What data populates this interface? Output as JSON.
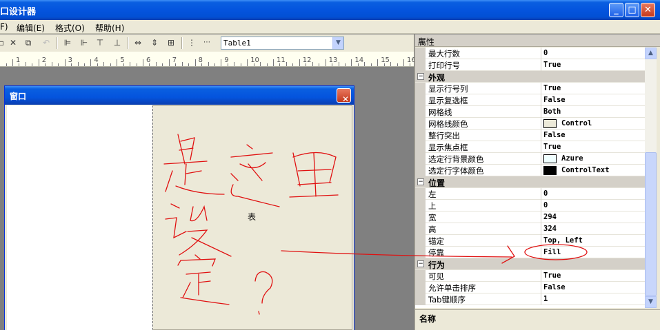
{
  "window": {
    "title": "口设计器",
    "min_glyph": "_",
    "max_glyph": "□",
    "close_glyph": "✕"
  },
  "menu": [
    {
      "label": "F)"
    },
    {
      "label": "编辑(E)"
    },
    {
      "label": "格式(O)"
    },
    {
      "label": "帮助(H)"
    }
  ],
  "toolbar": {
    "object_combo_value": "Table1"
  },
  "ruler": {
    "numbers": [
      "1",
      "2",
      "3",
      "4",
      "5",
      "6",
      "7",
      "8",
      "9",
      "10",
      "11",
      "12",
      "13",
      "14",
      "15",
      "16"
    ]
  },
  "designer": {
    "window_title": "窗口",
    "table_label": "表"
  },
  "annotation": {
    "handwritten_text": "是这里设定?"
  },
  "properties": {
    "header": "属性",
    "rows": [
      {
        "type": "prop",
        "label": "最大行数",
        "value": "0"
      },
      {
        "type": "prop",
        "label": "打印行号",
        "value": "True"
      },
      {
        "type": "cat",
        "label": "外观"
      },
      {
        "type": "prop",
        "label": "显示行号列",
        "value": "True"
      },
      {
        "type": "prop",
        "label": "显示复选框",
        "value": "False"
      },
      {
        "type": "prop",
        "label": "网格线",
        "value": "Both"
      },
      {
        "type": "prop",
        "label": "网格线颜色",
        "value": "Control",
        "swatch": "#ece9d8"
      },
      {
        "type": "prop",
        "label": "整行突出",
        "value": "False"
      },
      {
        "type": "prop",
        "label": "显示焦点框",
        "value": "True"
      },
      {
        "type": "prop",
        "label": "选定行背景颜色",
        "value": "Azure",
        "swatch": "#f0ffff"
      },
      {
        "type": "prop",
        "label": "选定行字体颜色",
        "value": "ControlText",
        "swatch": "#000000"
      },
      {
        "type": "cat",
        "label": "位置"
      },
      {
        "type": "prop",
        "label": "左",
        "value": "0"
      },
      {
        "type": "prop",
        "label": "上",
        "value": "0"
      },
      {
        "type": "prop",
        "label": "宽",
        "value": "294"
      },
      {
        "type": "prop",
        "label": "高",
        "value": "324"
      },
      {
        "type": "prop",
        "label": "锚定",
        "value": "Top, Left"
      },
      {
        "type": "prop",
        "label": "停靠",
        "value": "Fill"
      },
      {
        "type": "cat",
        "label": "行为"
      },
      {
        "type": "prop",
        "label": "可见",
        "value": "True"
      },
      {
        "type": "prop",
        "label": "允许单击排序",
        "value": "False"
      },
      {
        "type": "prop",
        "label": "Tab键顺序",
        "value": "1"
      }
    ],
    "description_title": "名称"
  },
  "colors": {
    "annotation": "#e01010",
    "titlebar": "#0454de"
  }
}
